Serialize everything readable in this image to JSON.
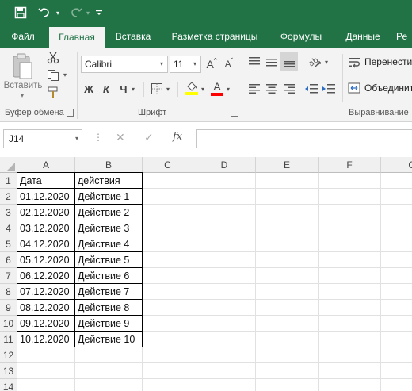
{
  "qat": {
    "save_icon": "save-icon",
    "undo_icon": "undo-icon",
    "redo_icon": "redo-icon",
    "customize_icon": "customize-icon"
  },
  "tabs": [
    "Файл",
    "Главная",
    "Вставка",
    "Разметка страницы",
    "Формулы",
    "Данные",
    "Ре"
  ],
  "ribbon": {
    "clipboard": {
      "paste_label": "Вставить",
      "group_label": "Буфер обмена"
    },
    "font": {
      "font_name": "Calibri",
      "font_size": "11",
      "bold": "Ж",
      "italic": "К",
      "underline": "Ч",
      "grow": "A",
      "shrink": "A",
      "font_color_letter": "A",
      "group_label": "Шрифт",
      "highlight_color": "#FFFF00",
      "font_color": "#FF0000"
    },
    "alignment": {
      "wrap_label": "Перенести",
      "merge_label": "Объединит",
      "group_label": "Выравнивание"
    }
  },
  "formula_bar": {
    "name_box": "J14",
    "cancel": "✕",
    "enter": "✓",
    "fx": "fx",
    "value": ""
  },
  "sheet": {
    "columns": [
      "A",
      "B",
      "C",
      "D",
      "E",
      "F",
      "G"
    ],
    "rows": [
      "1",
      "2",
      "3",
      "4",
      "5",
      "6",
      "7",
      "8",
      "9",
      "10",
      "11",
      "12",
      "13",
      "14"
    ],
    "data": [
      [
        "Дата",
        "действия"
      ],
      [
        "01.12.2020",
        "Действие 1"
      ],
      [
        "02.12.2020",
        "Действие 2"
      ],
      [
        "03.12.2020",
        "Действие 3"
      ],
      [
        "04.12.2020",
        "Действие 4"
      ],
      [
        "05.12.2020",
        "Действие 5"
      ],
      [
        "06.12.2020",
        "Действие 6"
      ],
      [
        "07.12.2020",
        "Действие 7"
      ],
      [
        "08.12.2020",
        "Действие 8"
      ],
      [
        "09.12.2020",
        "Действие 9"
      ],
      [
        "10.12.2020",
        "Действие 10"
      ]
    ]
  },
  "colors": {
    "brand": "#217346",
    "ribbon_bg": "#F3F3F3",
    "grid_line": "#E1E1E1"
  }
}
